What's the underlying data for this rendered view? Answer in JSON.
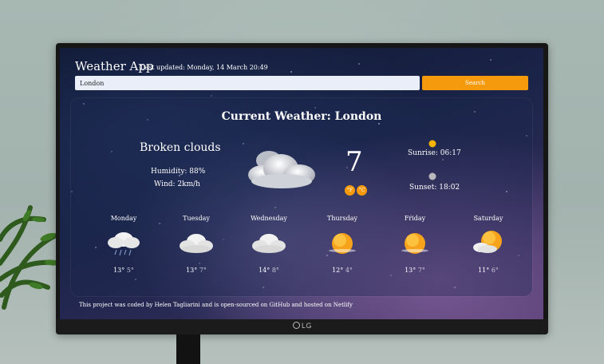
{
  "app": {
    "title": "Weather App",
    "last_updated": "Last updated: Monday, 14 March 20:49"
  },
  "search": {
    "value": "London",
    "button_label": "Search"
  },
  "current": {
    "heading": "Current Weather: London",
    "description": "Broken clouds",
    "humidity": "Humidity: 88%",
    "wind": "Wind: 2km/h",
    "temperature": "7",
    "unit_f": "°F",
    "unit_c": "°C",
    "sunrise": "Sunrise: 06:17",
    "sunset": "Sunset: 18:02",
    "icon": "broken-clouds-icon"
  },
  "forecast": [
    {
      "day": "Monday",
      "high": "13°",
      "low": "5°",
      "icon": "rain-cloud-icon"
    },
    {
      "day": "Tuesday",
      "high": "13°",
      "low": "7°",
      "icon": "cloud-icon"
    },
    {
      "day": "Wednesday",
      "high": "14°",
      "low": "8°",
      "icon": "cloud-icon"
    },
    {
      "day": "Thursday",
      "high": "12°",
      "low": "4°",
      "icon": "sun-icon"
    },
    {
      "day": "Friday",
      "high": "13°",
      "low": "7°",
      "icon": "sun-icon"
    },
    {
      "day": "Saturday",
      "high": "11°",
      "low": "6°",
      "icon": "partly-cloudy-icon"
    }
  ],
  "footer": {
    "text": "This project was coded by Helen Tagliarini and is open-sourced on GitHub and hosted on Netlify"
  },
  "device": {
    "brand": "LG"
  },
  "colors": {
    "accent": "#f59a0c",
    "input_bg": "#e9eef8"
  }
}
